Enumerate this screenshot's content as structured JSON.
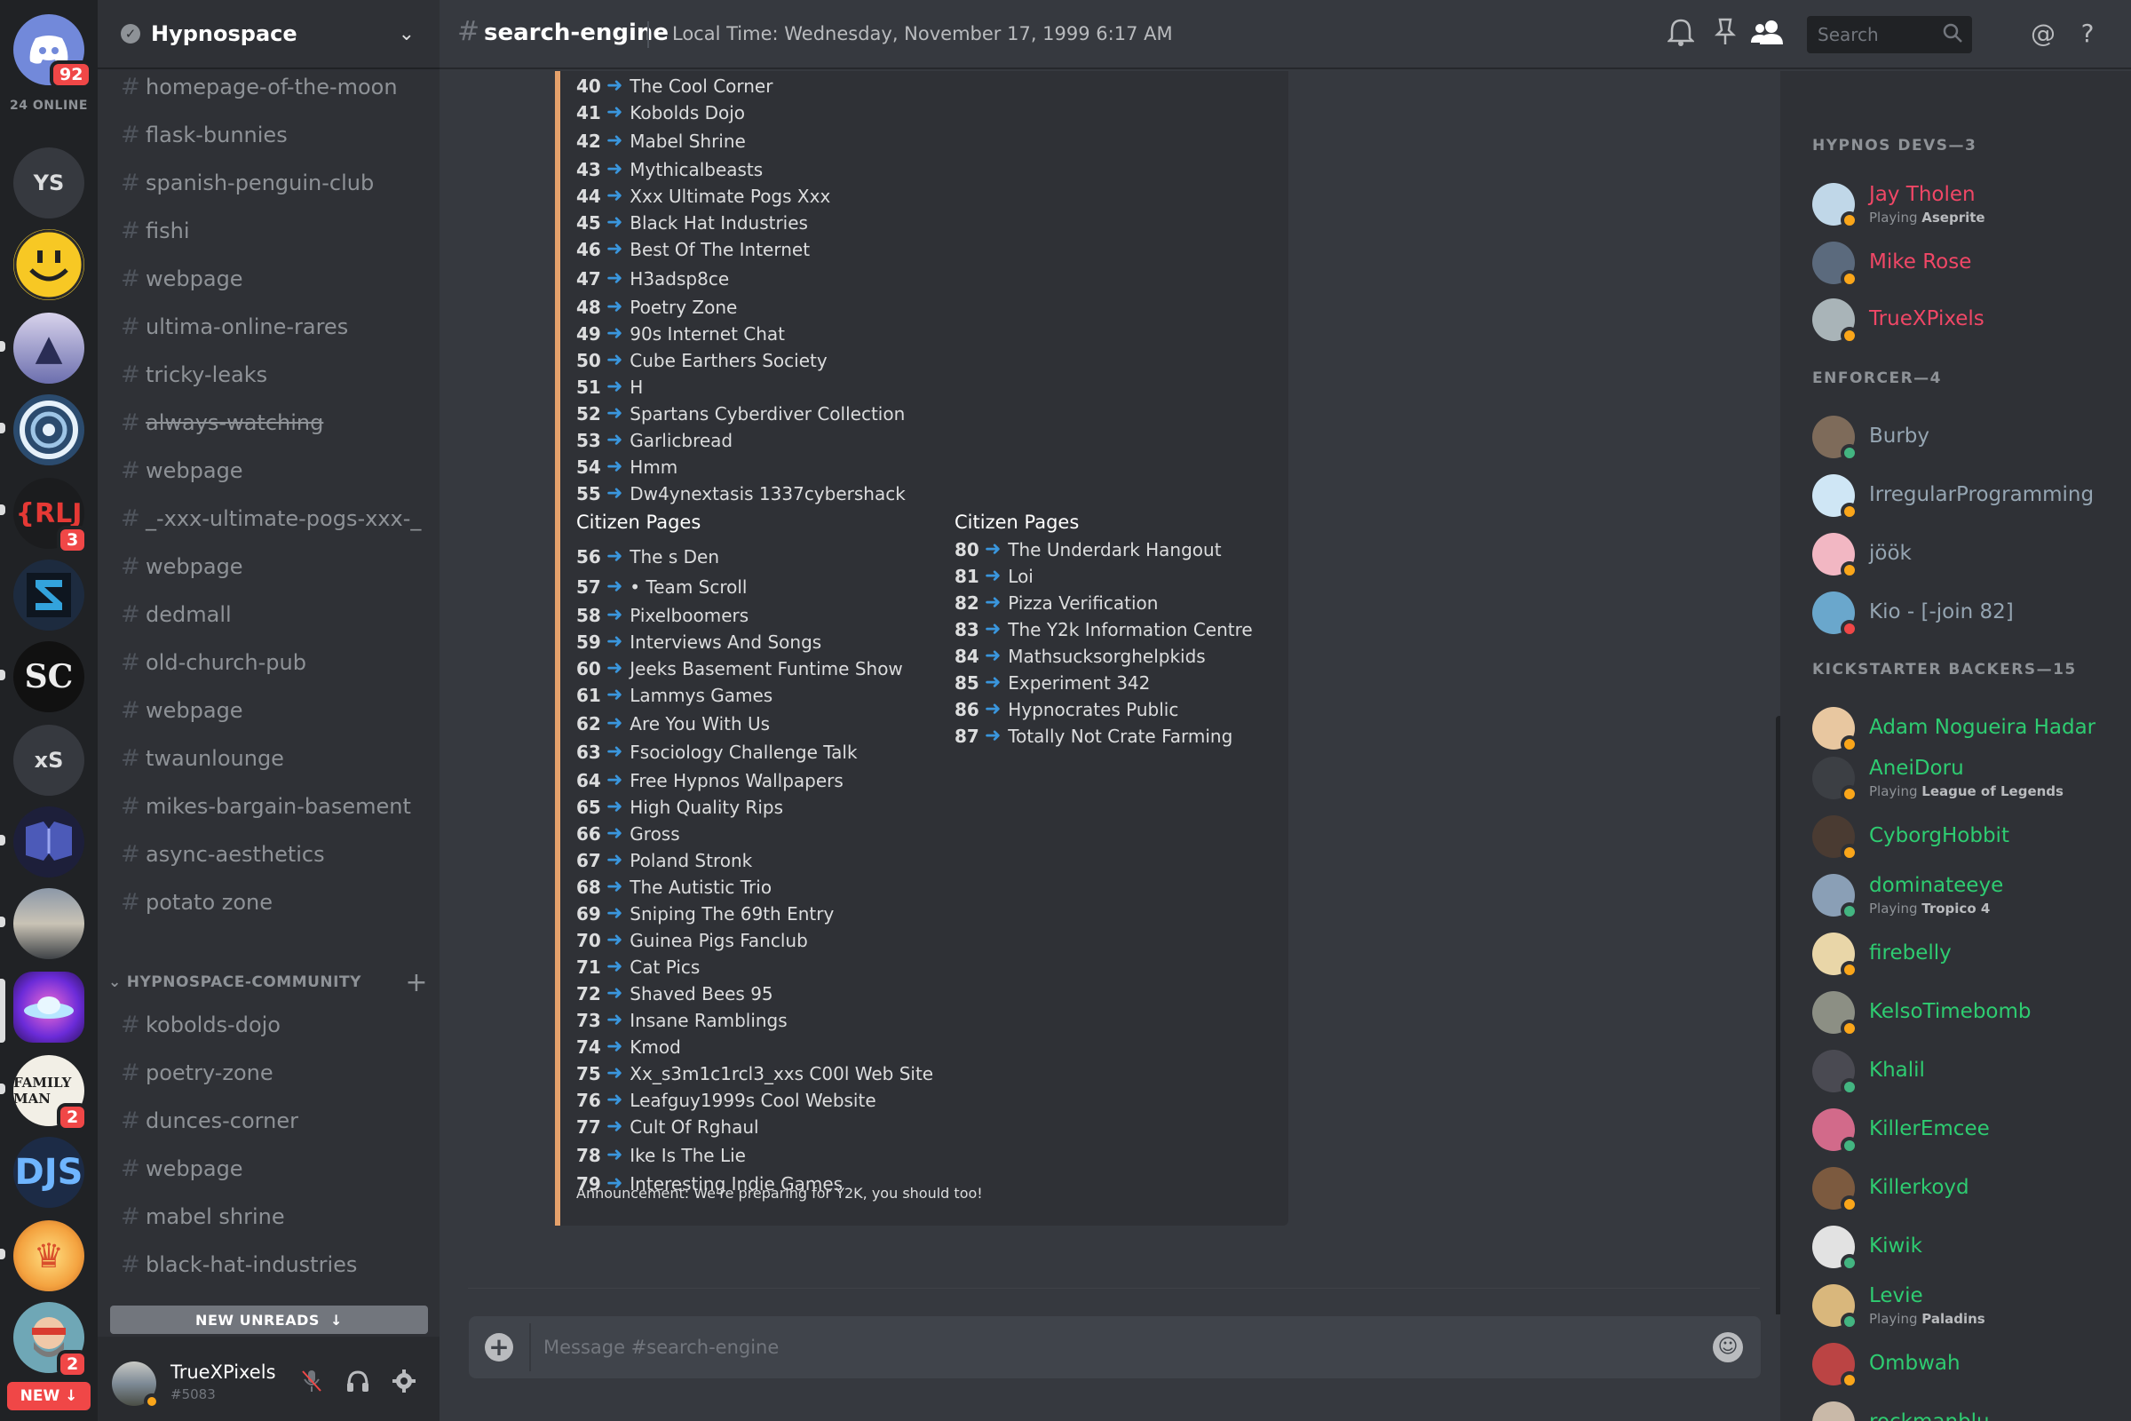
{
  "servers": {
    "home_badge": "92",
    "online": "24 ONLINE",
    "items": [
      "YS",
      "xS"
    ],
    "badges": {
      "rlj": "3",
      "family": "2",
      "bottom": "2"
    },
    "new_label": "NEW"
  },
  "guild": {
    "name": "Hypnospace",
    "channels": [
      "homepage-of-the-moon",
      "flask-bunnies",
      "spanish-penguin-club",
      "fishi",
      "webpage",
      "ultima-online-rares",
      "tricky-leaks",
      "always-watching",
      "webpage",
      "_-xxx-ultimate-pogs-xxx-_",
      "webpage",
      "dedmall",
      "old-church-pub",
      "webpage",
      "twaunlounge",
      "mikes-bargain-basement",
      "async-aesthetics",
      "potato zone"
    ],
    "category": "HYPNOSPACE-COMMUNITY",
    "community_channels": [
      "kobolds-dojo",
      "poetry-zone",
      "dunces-corner",
      "webpage",
      "mabel shrine",
      "black-hat-industries"
    ],
    "new_unreads": "NEW UNREADS"
  },
  "user": {
    "name": "TrueXPixels",
    "tag": "#5083"
  },
  "topbar": {
    "channel": "search-engine",
    "topic": "Local Time: Wednesday, November 17, 1999 6:17 AM",
    "search_placeholder": "Search"
  },
  "embed": {
    "list_a": [
      {
        "n": "40",
        "t": "The Cool Corner"
      },
      {
        "n": "41",
        "t": "Kobolds Dojo"
      },
      {
        "n": "42",
        "t": "Mabel  Shrine"
      },
      {
        "n": "43",
        "t": "Mythicalbeasts"
      },
      {
        "n": "44",
        "t": "Xxx Ultimate Pogs Xxx"
      },
      {
        "n": "45",
        "t": "Black Hat Industries"
      },
      {
        "n": "46",
        "t": "Best Of The Internet"
      },
      {
        "n": "47",
        "t": "H3adsp8ce"
      },
      {
        "n": "48",
        "t": "Poetry Zone"
      },
      {
        "n": "49",
        "t": "90s Internet Chat"
      },
      {
        "n": "50",
        "t": "Cube Earthers Society"
      },
      {
        "n": "51",
        "t": "H"
      },
      {
        "n": "52",
        "t": "Spartans Cyberdiver Collection"
      },
      {
        "n": "53",
        "t": "Garlicbread"
      },
      {
        "n": "54",
        "t": "Hmm"
      },
      {
        "n": "55",
        "t": "Dw4ynextasis 1337cybershack"
      }
    ],
    "citizen_heading": "Citizen Pages",
    "list_b": [
      {
        "n": "56",
        "t": "The  s Den"
      },
      {
        "n": "57",
        "t": "• Team Scroll"
      },
      {
        "n": "58",
        "t": "Pixelboomers"
      },
      {
        "n": "59",
        "t": "Interviews And Songs"
      },
      {
        "n": "60",
        "t": "Jeeks Basement Funtime Show"
      },
      {
        "n": "61",
        "t": "Lammys Games"
      },
      {
        "n": "62",
        "t": "Are You With Us"
      },
      {
        "n": "63",
        "t": "Fsociology Challenge Talk"
      },
      {
        "n": "64",
        "t": "Free Hypnos Wallpapers"
      },
      {
        "n": "65",
        "t": "High Quality Rips"
      },
      {
        "n": "66",
        "t": "Gross"
      },
      {
        "n": "67",
        "t": "Poland Stronk"
      },
      {
        "n": "68",
        "t": "The Autistic Trio"
      },
      {
        "n": "69",
        "t": "Sniping The 69th Entry"
      },
      {
        "n": "70",
        "t": "Guinea Pigs Fanclub"
      },
      {
        "n": "71",
        "t": "Cat Pics"
      },
      {
        "n": "72",
        "t": "Shaved Bees 95"
      },
      {
        "n": "73",
        "t": "Insane Ramblings"
      },
      {
        "n": "74",
        "t": "Kmod"
      },
      {
        "n": "75",
        "t": "Xx_s3m1c1rcl3_xxs C00l Web Site"
      },
      {
        "n": "76",
        "t": "Leafguy1999s Cool Website"
      },
      {
        "n": "77",
        "t": "Cult Of Rghaul"
      },
      {
        "n": "78",
        "t": "Ike Is The Lie"
      },
      {
        "n": "79",
        "t": "Interesting Indie Games"
      }
    ],
    "list_c": [
      {
        "n": "80",
        "t": "The Underdark Hangout"
      },
      {
        "n": "81",
        "t": "Loi"
      },
      {
        "n": "82",
        "t": "Pizza Verification"
      },
      {
        "n": "83",
        "t": "The Y2k Information Centre"
      },
      {
        "n": "84",
        "t": "Mathsucksorghelpkids"
      },
      {
        "n": "85",
        "t": "Experiment 342"
      },
      {
        "n": "86",
        "t": "Hypnocrates Public"
      },
      {
        "n": "87",
        "t": "Totally Not Crate Farming"
      }
    ],
    "announcement": "Announcement: We're preparing for Y2K, you should too!"
  },
  "composer": {
    "placeholder": "Message #search-engine"
  },
  "members": {
    "groups": [
      {
        "title": "HYPNOS DEVS—3",
        "color": "#f04766",
        "people": [
          {
            "name": "Jay Tholen",
            "playing": "Playing",
            "game": "Aseprite",
            "status": "#faa61a"
          },
          {
            "name": "Mike Rose",
            "status": "#faa61a"
          },
          {
            "name": "TrueXPixels",
            "status": "#faa61a"
          }
        ]
      },
      {
        "title": "ENFORCER—4",
        "color": "#95a5b2",
        "people": [
          {
            "name": "Burby",
            "status": "#43b581"
          },
          {
            "name": "IrregularProgramming",
            "status": "#faa61a"
          },
          {
            "name": "jöök",
            "status": "#faa61a"
          },
          {
            "name": "Kio - [-join 82]",
            "status": "#f04747"
          }
        ]
      },
      {
        "title": "KICKSTARTER BACKERS—15",
        "color": "#2ecc71",
        "people": [
          {
            "name": "Adam Nogueira Hadar",
            "status": "#faa61a"
          },
          {
            "name": "AneiDoru",
            "playing": "Playing",
            "game": "League of Legends",
            "status": "#faa61a"
          },
          {
            "name": "CyborgHobbit",
            "status": "#faa61a"
          },
          {
            "name": "dominateeye",
            "playing": "Playing",
            "game": "Tropico 4",
            "status": "#43b581"
          },
          {
            "name": "firebelly",
            "status": "#faa61a"
          },
          {
            "name": "KelsoTimebomb",
            "status": "#faa61a"
          },
          {
            "name": "Khalil",
            "status": "#43b581"
          },
          {
            "name": "KillerEmcee",
            "status": "#43b581"
          },
          {
            "name": "Killerkoyd",
            "status": "#faa61a"
          },
          {
            "name": "Kiwik",
            "status": "#43b581"
          },
          {
            "name": "Levie",
            "playing": "Playing",
            "game": "Paladins",
            "status": "#43b581"
          },
          {
            "name": "Ombwah",
            "status": "#faa61a"
          },
          {
            "name": "rockmanblu",
            "status": "#faa61a"
          }
        ]
      }
    ]
  }
}
